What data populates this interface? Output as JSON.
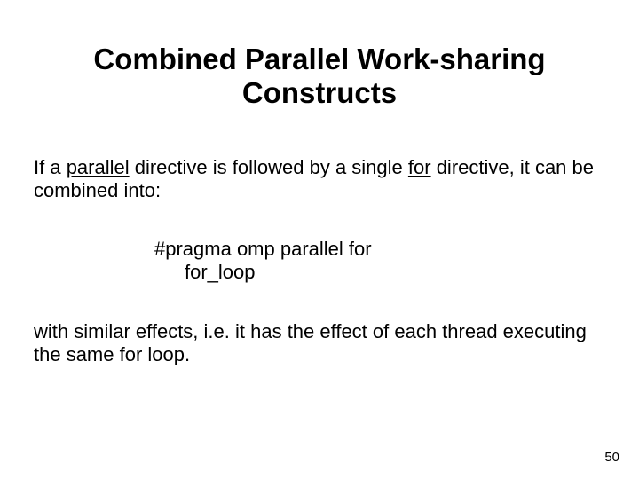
{
  "title_line1": "Combined Parallel Work-sharing",
  "title_line2": "Constructs",
  "para1_a": "If a ",
  "para1_u1": "parallel",
  "para1_b": " directive is followed by a single ",
  "para1_u2": "for",
  "para1_c": " directive, it can be combined into:",
  "code": {
    "line1": "#pragma omp parallel for",
    "line2": "for_loop"
  },
  "para2": "with similar effects, i.e. it has the effect of each thread executing the same for loop.",
  "page_number": "50"
}
